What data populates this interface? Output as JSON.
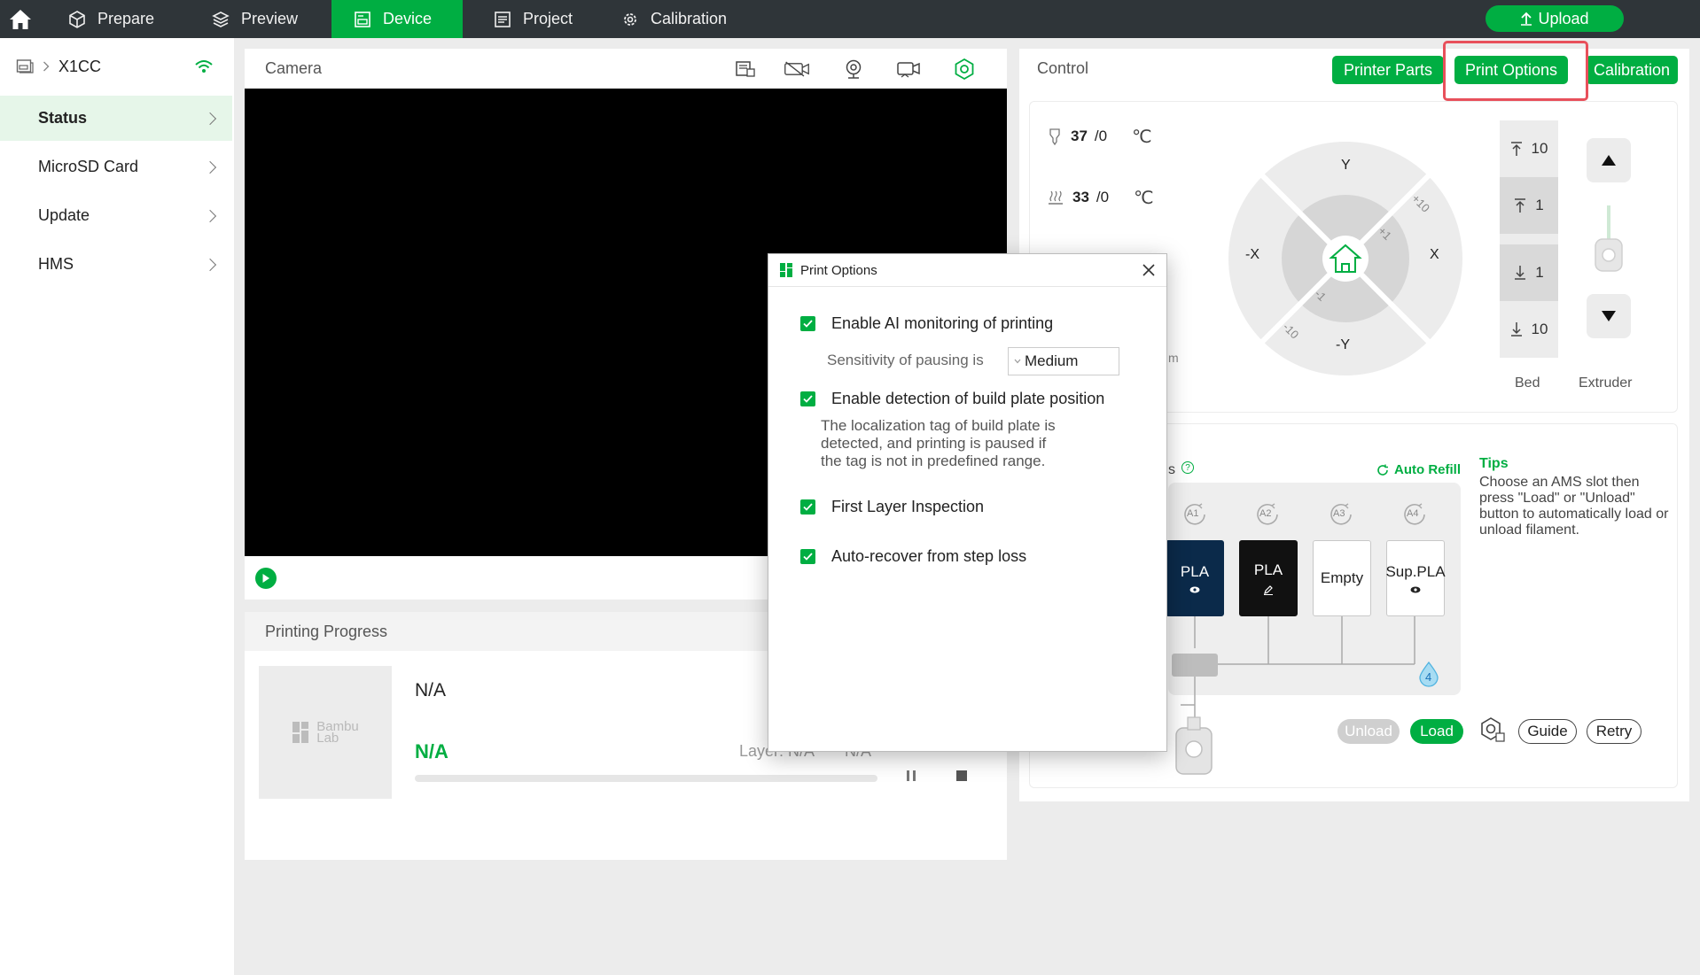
{
  "nav": {
    "tabs": [
      {
        "label": "Prepare"
      },
      {
        "label": "Preview"
      },
      {
        "label": "Device"
      },
      {
        "label": "Project"
      },
      {
        "label": "Calibration"
      }
    ],
    "upload_label": "Upload"
  },
  "sidebar": {
    "printer_name": "X1CC",
    "items": [
      {
        "label": "Status"
      },
      {
        "label": "MicroSD Card"
      },
      {
        "label": "Update"
      },
      {
        "label": "HMS"
      }
    ]
  },
  "camera": {
    "title": "Camera"
  },
  "progress": {
    "title": "Printing Progress",
    "task_name": "N/A",
    "percent": "N/A",
    "layer": "Layer: N/A",
    "time": "N/A",
    "thumb_brand_line1": "Bambu",
    "thumb_brand_line2": "Lab"
  },
  "control": {
    "title": "Control",
    "buttons": {
      "printer_parts": "Printer Parts",
      "print_options": "Print Options",
      "calibration": "Calibration"
    },
    "nozzle": {
      "current": "37",
      "target": "/0",
      "unit": "℃"
    },
    "bed_temp": {
      "current": "33",
      "target": "/0",
      "unit": "℃"
    },
    "jog": {
      "y_plus": "Y",
      "y_minus": "-Y",
      "x_plus": "X",
      "x_minus": "-X",
      "plus10": "+10",
      "plus1": "+1",
      "minus1": "-1",
      "minus10": "-10"
    },
    "bed_steps": [
      "10",
      "1",
      "1",
      "10"
    ],
    "bed_label": "Bed",
    "extruder_label": "Extruder",
    "partial_m": "m"
  },
  "ams": {
    "title_partial": "s",
    "auto_refill": "Auto Refill",
    "slots": [
      {
        "tag": "A1",
        "label": "PLA",
        "color": "#0b2a4a"
      },
      {
        "tag": "A2",
        "label": "PLA",
        "color": "#111111"
      },
      {
        "tag": "A3",
        "label": "Empty",
        "color": "#ffffff"
      },
      {
        "tag": "A4",
        "label": "Sup.PLA",
        "color": "#ffffff"
      }
    ],
    "drop_number": "4",
    "buttons": {
      "unload": "Unload",
      "load": "Load",
      "guide": "Guide",
      "retry": "Retry"
    },
    "tips_title": "Tips",
    "tips_text": "Choose an AMS slot then press \"Load\" or \"Unload\" button to automatically load or unload filament."
  },
  "dialog": {
    "title": "Print Options",
    "options": [
      {
        "label": "Enable AI monitoring of printing",
        "checked": true
      },
      {
        "label": "Enable detection of build plate position",
        "checked": true
      },
      {
        "label": "First Layer Inspection",
        "checked": true
      },
      {
        "label": "Auto-recover from step loss",
        "checked": true
      }
    ],
    "sensitivity_label": "Sensitivity of pausing is",
    "sensitivity_value": "Medium",
    "plate_desc_lines": [
      "The localization tag of build plate is",
      "detected, and printing is paused if",
      "the tag is not in predefined range."
    ]
  },
  "colors": {
    "accent": "#00ae42",
    "topbar": "#2f3539",
    "highlight": "#e8505b"
  }
}
